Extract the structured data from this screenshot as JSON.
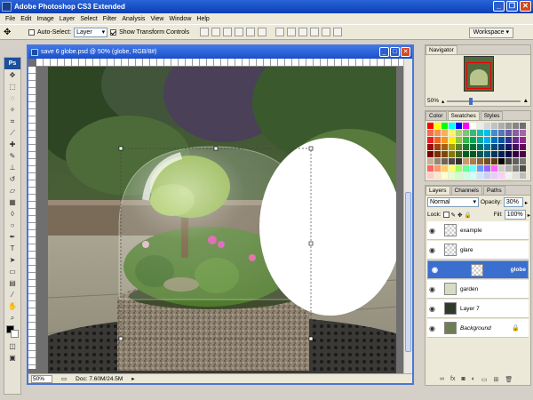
{
  "app": {
    "title": "Adobe Photoshop CS3 Extended"
  },
  "menu": [
    "File",
    "Edit",
    "Image",
    "Layer",
    "Select",
    "Filter",
    "Analysis",
    "View",
    "Window",
    "Help"
  ],
  "options": {
    "auto_select_label": "Auto-Select:",
    "auto_select_value": "Layer",
    "transform_controls_label": "Show Transform Controls",
    "workspace_label": "Workspace"
  },
  "document": {
    "title": "save 6 globe.psd @ 50% (globe, RGB/8#)",
    "zoom": "50%",
    "doc_info": "Doc: 7.60M/24.5M"
  },
  "toolbox": {
    "logo": "Ps"
  },
  "navigator": {
    "tab": "Navigator",
    "zoom": "50%"
  },
  "swatches": {
    "tabs": [
      "Color",
      "Swatches",
      "Styles"
    ],
    "active_tab": "Swatches",
    "colors": [
      "#ff0000",
      "#ffff00",
      "#00ff00",
      "#00ffff",
      "#0000ff",
      "#ff00ff",
      "#ffffff",
      "#ebebeb",
      "#d6d6d6",
      "#c2c2c2",
      "#adadad",
      "#999999",
      "#858585",
      "#707070",
      "#f26c4f",
      "#f68e55",
      "#fbaf5c",
      "#fff467",
      "#acd372",
      "#7cc576",
      "#3bb878",
      "#1abbb4",
      "#00bff3",
      "#438ccb",
      "#5574b9",
      "#605ca8",
      "#855fa8",
      "#a763a9",
      "#ed1c24",
      "#f26522",
      "#f7941d",
      "#fff200",
      "#8dc63f",
      "#39b54a",
      "#00a651",
      "#00a99d",
      "#00aeef",
      "#0072bc",
      "#0054a6",
      "#2e3192",
      "#662d91",
      "#92278f",
      "#9e0b0f",
      "#a0410d",
      "#a3620a",
      "#aba000",
      "#598527",
      "#1a7b30",
      "#007236",
      "#00746b",
      "#0076a3",
      "#004b80",
      "#003471",
      "#1b1464",
      "#440e62",
      "#630460",
      "#790000",
      "#7b2e00",
      "#7d4900",
      "#827b00",
      "#406618",
      "#005e20",
      "#005826",
      "#005952",
      "#005b7f",
      "#003663",
      "#002157",
      "#0d004c",
      "#32004b",
      "#4b0049",
      "#c7b299",
      "#998675",
      "#736357",
      "#534741",
      "#37302d",
      "#c69c6d",
      "#a67c52",
      "#8c6239",
      "#754c24",
      "#603913",
      "#000000",
      "#464646",
      "#5f5f5f",
      "#777777",
      "#ff6666",
      "#ff9966",
      "#ffcc66",
      "#ffff66",
      "#99ff66",
      "#66ff99",
      "#66ffff",
      "#6699ff",
      "#9966ff",
      "#ff66ff",
      "#cccccc",
      "#b3b3b3",
      "#808080",
      "#4d4d4d",
      "#ffcccc",
      "#ffe5cc",
      "#ffffcc",
      "#e5ffcc",
      "#ccffcc",
      "#ccffe5",
      "#ccffff",
      "#cce5ff",
      "#ccccff",
      "#e5ccff",
      "#ffccff",
      "#f2f2f2",
      "#e0e0e0",
      "#bdbdbd"
    ]
  },
  "layers": {
    "tabs": [
      "Layers",
      "Channels",
      "Paths"
    ],
    "active_tab": "Layers",
    "blend_mode": "Normal",
    "opacity_label": "Opacity:",
    "opacity": "30%",
    "lock_label": "Lock:",
    "fill_label": "Fill:",
    "fill": "100%",
    "items": [
      {
        "name": "example",
        "thumb": "chk",
        "selected": false,
        "locked": false
      },
      {
        "name": "glare",
        "thumb": "chk",
        "selected": false,
        "locked": false
      },
      {
        "name": "globe",
        "thumb": "chk",
        "selected": true,
        "locked": false
      },
      {
        "name": "garden",
        "thumb": "garden",
        "selected": false,
        "locked": false
      },
      {
        "name": "Layer 7",
        "thumb": "dark",
        "selected": false,
        "locked": false
      },
      {
        "name": "Background",
        "thumb": "img",
        "selected": false,
        "locked": true
      }
    ]
  }
}
